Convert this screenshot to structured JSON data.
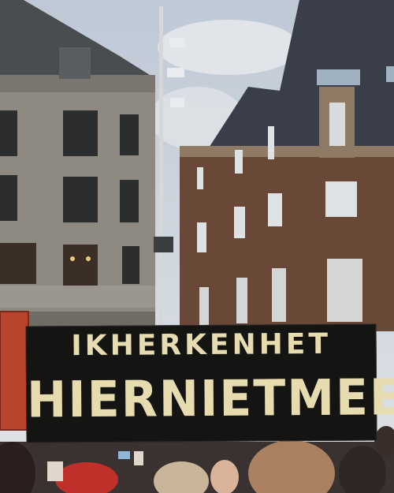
{
  "scene": {
    "description_colors": {
      "sky": "#c9d2dc",
      "left_building": "#8f8a82",
      "right_building": "#6b4a3a",
      "roof": "#3b3f4a",
      "sign_background": "#141413",
      "sign_text": "#e6dcb0",
      "side_sign": "#b8442e"
    }
  },
  "protest_sign": {
    "line1": "IKHERKENHET",
    "line2": "HIERNIETMEER"
  }
}
